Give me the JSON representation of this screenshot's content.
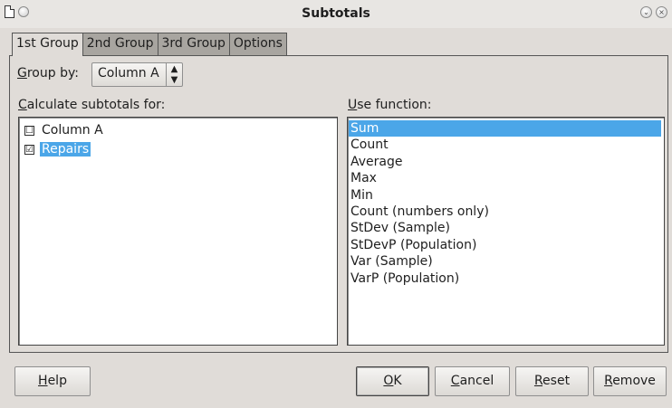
{
  "window": {
    "title": "Subtotals"
  },
  "tabs": [
    {
      "label": "1st Group",
      "active": true
    },
    {
      "label": "2nd Group",
      "active": false
    },
    {
      "label": "3rd Group",
      "active": false
    },
    {
      "label": "Options",
      "active": false
    }
  ],
  "group_by": {
    "label_accel": "G",
    "label_rest": "roup by:",
    "value": "Column A"
  },
  "calc_subtotals": {
    "label_accel": "C",
    "label_rest": "alculate subtotals for:",
    "items": [
      {
        "label": "Column A",
        "checked": false,
        "selected": false,
        "mark": "☐"
      },
      {
        "label": "Repairs",
        "checked": true,
        "selected": true,
        "mark": "☑"
      }
    ]
  },
  "use_function": {
    "label_accel": "U",
    "label_rest": "se function:",
    "items": [
      {
        "label": "Sum",
        "selected": true
      },
      {
        "label": "Count",
        "selected": false
      },
      {
        "label": "Average",
        "selected": false
      },
      {
        "label": "Max",
        "selected": false
      },
      {
        "label": "Min",
        "selected": false
      },
      {
        "label": "Count (numbers only)",
        "selected": false
      },
      {
        "label": "StDev (Sample)",
        "selected": false
      },
      {
        "label": "StDevP (Population)",
        "selected": false
      },
      {
        "label": "Var (Sample)",
        "selected": false
      },
      {
        "label": "VarP (Population)",
        "selected": false
      }
    ]
  },
  "buttons": {
    "help": {
      "accel": "H",
      "rest": "elp"
    },
    "ok": {
      "accel": "O",
      "rest": "K"
    },
    "cancel": {
      "accel": "C",
      "rest": "ancel"
    },
    "reset": {
      "accel": "R",
      "rest": "eset"
    },
    "remove": {
      "accel": "R",
      "rest": "emove"
    }
  },
  "colors": {
    "selection": "#4ba6e8",
    "window_bg": "#e0dcd8"
  },
  "icons": {
    "document": "document-icon",
    "menu": "window-menu-icon",
    "minimize": "chevron-down-icon",
    "close": "close-icon"
  }
}
